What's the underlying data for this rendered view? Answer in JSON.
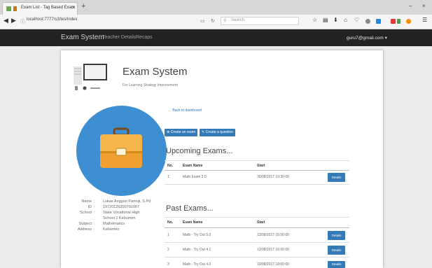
{
  "browser": {
    "tab_title": "Exam List - Tag Based Exam",
    "tab_close": "✕",
    "new_tab": "+",
    "url": "localhost:7777/s3/tes/index",
    "search_placeholder": "Search",
    "minimize": "–",
    "close": "×"
  },
  "navbar": {
    "brand": "Exam System",
    "links": [
      "Teacher Details",
      "Recaps"
    ],
    "user": "guru7@gmail.com ▾"
  },
  "header": {
    "title": "Exam System",
    "subtitle": "For Learning Strategy Improvement"
  },
  "profile": {
    "rows": [
      {
        "label": "Name",
        "value": "Lukas Anggun Pamuji, S.Pd"
      },
      {
        "label": "ID",
        "value": "19720126200701007"
      },
      {
        "label": "School",
        "value": "State Vocational High"
      },
      {
        "label": "",
        "value": "School 1 Kebumen"
      },
      {
        "label": "Subject",
        "value": "Mathematics"
      },
      {
        "label": "Address",
        "value": "Kebumen"
      }
    ]
  },
  "actions": {
    "back": "Back to dashboard",
    "create_exam": "Create an exam",
    "create_question": "Create a question"
  },
  "upcoming": {
    "heading": "Upcoming Exams...",
    "headers": [
      "No.",
      "Exam Name",
      "Start"
    ],
    "rows": [
      {
        "no": "1",
        "name": "Math Exam 2.0",
        "start": "30/08/2017 19:30:00",
        "button": "Details"
      }
    ]
  },
  "past": {
    "heading": "Past Exams...",
    "headers": [
      "No.",
      "Exam Name",
      "Start"
    ],
    "rows": [
      {
        "no": "1",
        "name": "Math - Try Out 5.0",
        "start": "13/08/2017 15:50:00",
        "button": "Details"
      },
      {
        "no": "2",
        "name": "Math - Try Out 4.1",
        "start": "13/08/2017 16:00:00",
        "button": "Details"
      },
      {
        "no": "3",
        "name": "Math - Try Out 4.0",
        "start": "10/08/2017 18:00:00",
        "button": "Details"
      }
    ]
  },
  "colors": {
    "primary": "#337ab7",
    "navbar": "#222222",
    "circle": "#3d8fd1",
    "briefcase": "#f0a030"
  }
}
